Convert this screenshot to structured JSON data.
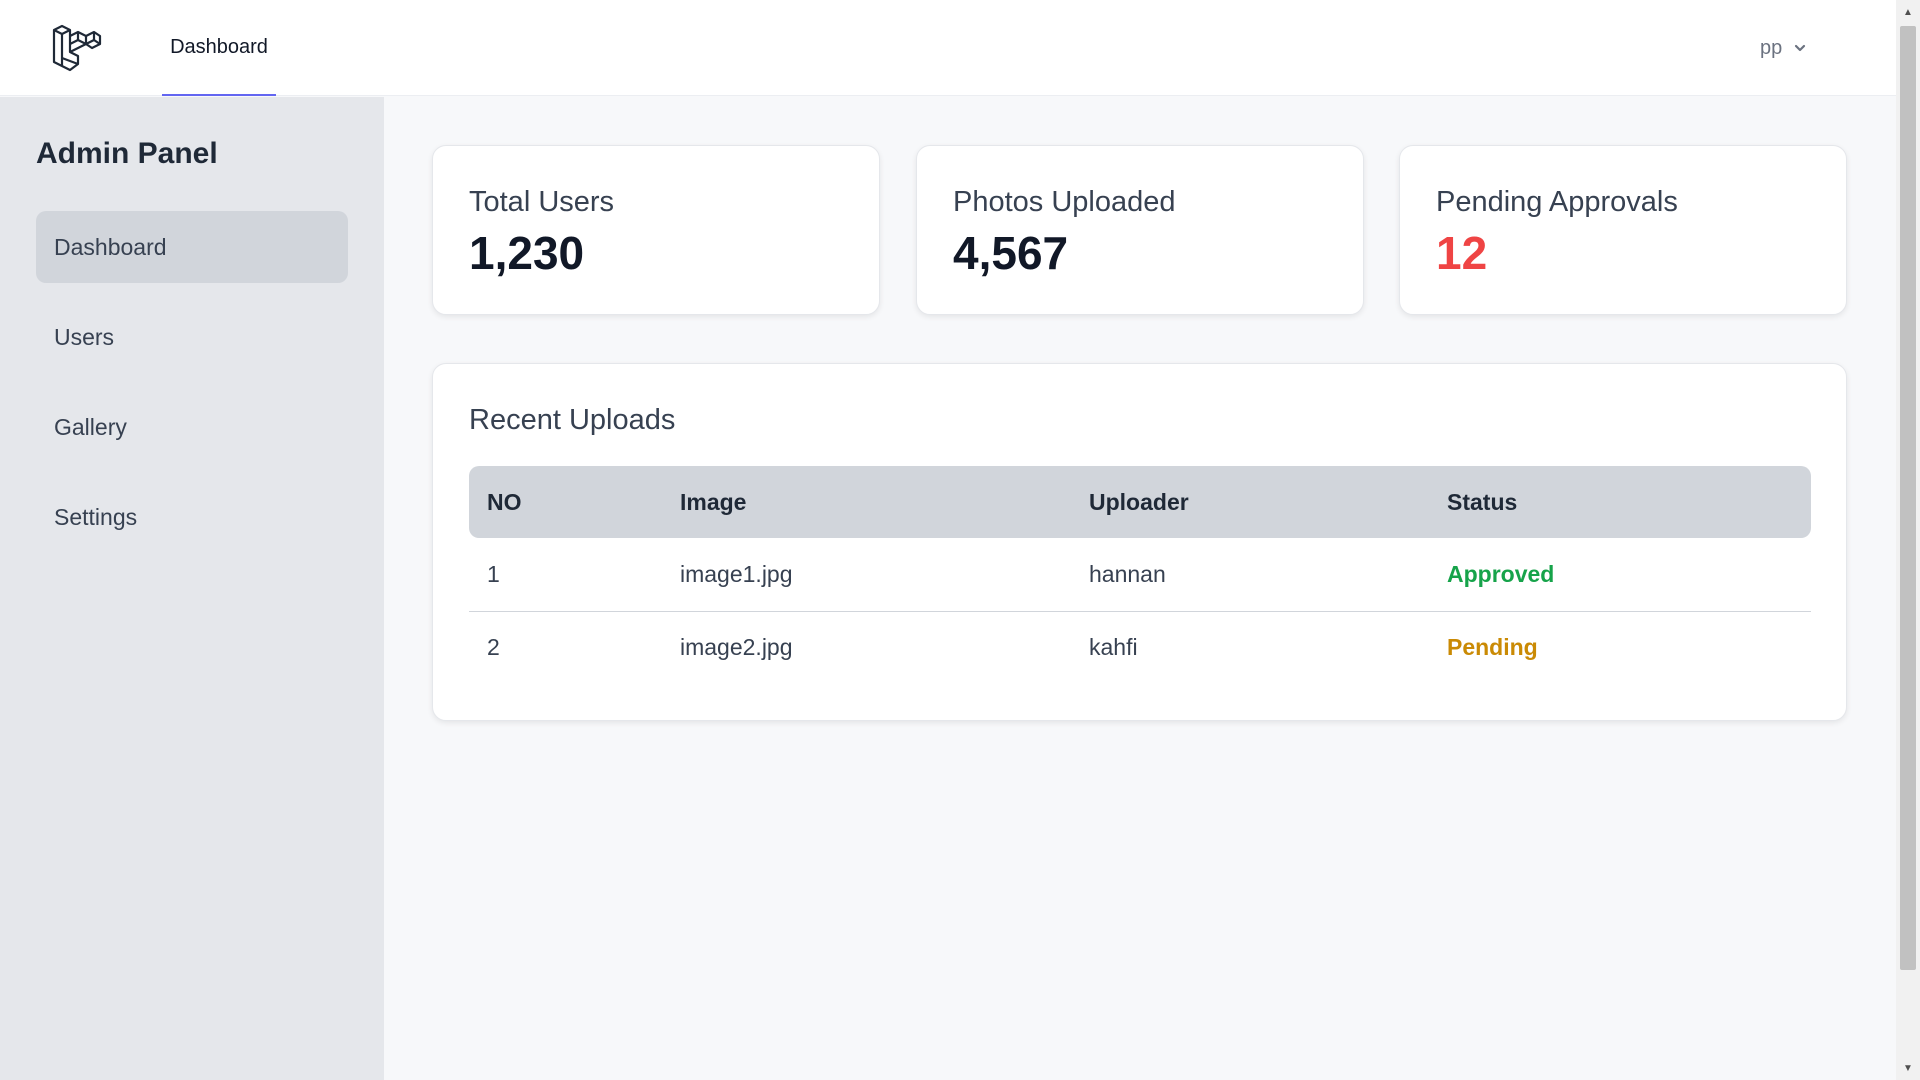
{
  "header": {
    "logo_icon": "laravel-logo-icon",
    "nav": {
      "dashboard_label": "Dashboard"
    },
    "user": {
      "name": "pp",
      "menu_icon": "chevron-down-icon"
    }
  },
  "sidebar": {
    "title": "Admin Panel",
    "items": [
      {
        "label": "Dashboard",
        "active": true
      },
      {
        "label": "Users",
        "active": false
      },
      {
        "label": "Gallery",
        "active": false
      },
      {
        "label": "Settings",
        "active": false
      }
    ]
  },
  "stats": [
    {
      "label": "Total Users",
      "value": "1,230"
    },
    {
      "label": "Photos Uploaded",
      "value": "4,567"
    },
    {
      "label": "Pending Approvals",
      "value": "12",
      "color": "#ef4444"
    }
  ],
  "recent_uploads": {
    "title": "Recent Uploads",
    "columns": [
      "NO",
      "Image",
      "Uploader",
      "Status"
    ],
    "rows": [
      {
        "no": "1",
        "image": "image1.jpg",
        "uploader": "hannan",
        "status": "Approved",
        "status_color": "#16a34a"
      },
      {
        "no": "2",
        "image": "image2.jpg",
        "uploader": "kahfi",
        "status": "Pending",
        "status_color": "#ca8a04"
      }
    ]
  },
  "colors": {
    "accent": "#6366f1",
    "sidebar_bg": "#e5e7eb",
    "active_item_bg": "#d1d5db",
    "approved": "#16a34a",
    "pending": "#ca8a04",
    "alert": "#ef4444"
  }
}
